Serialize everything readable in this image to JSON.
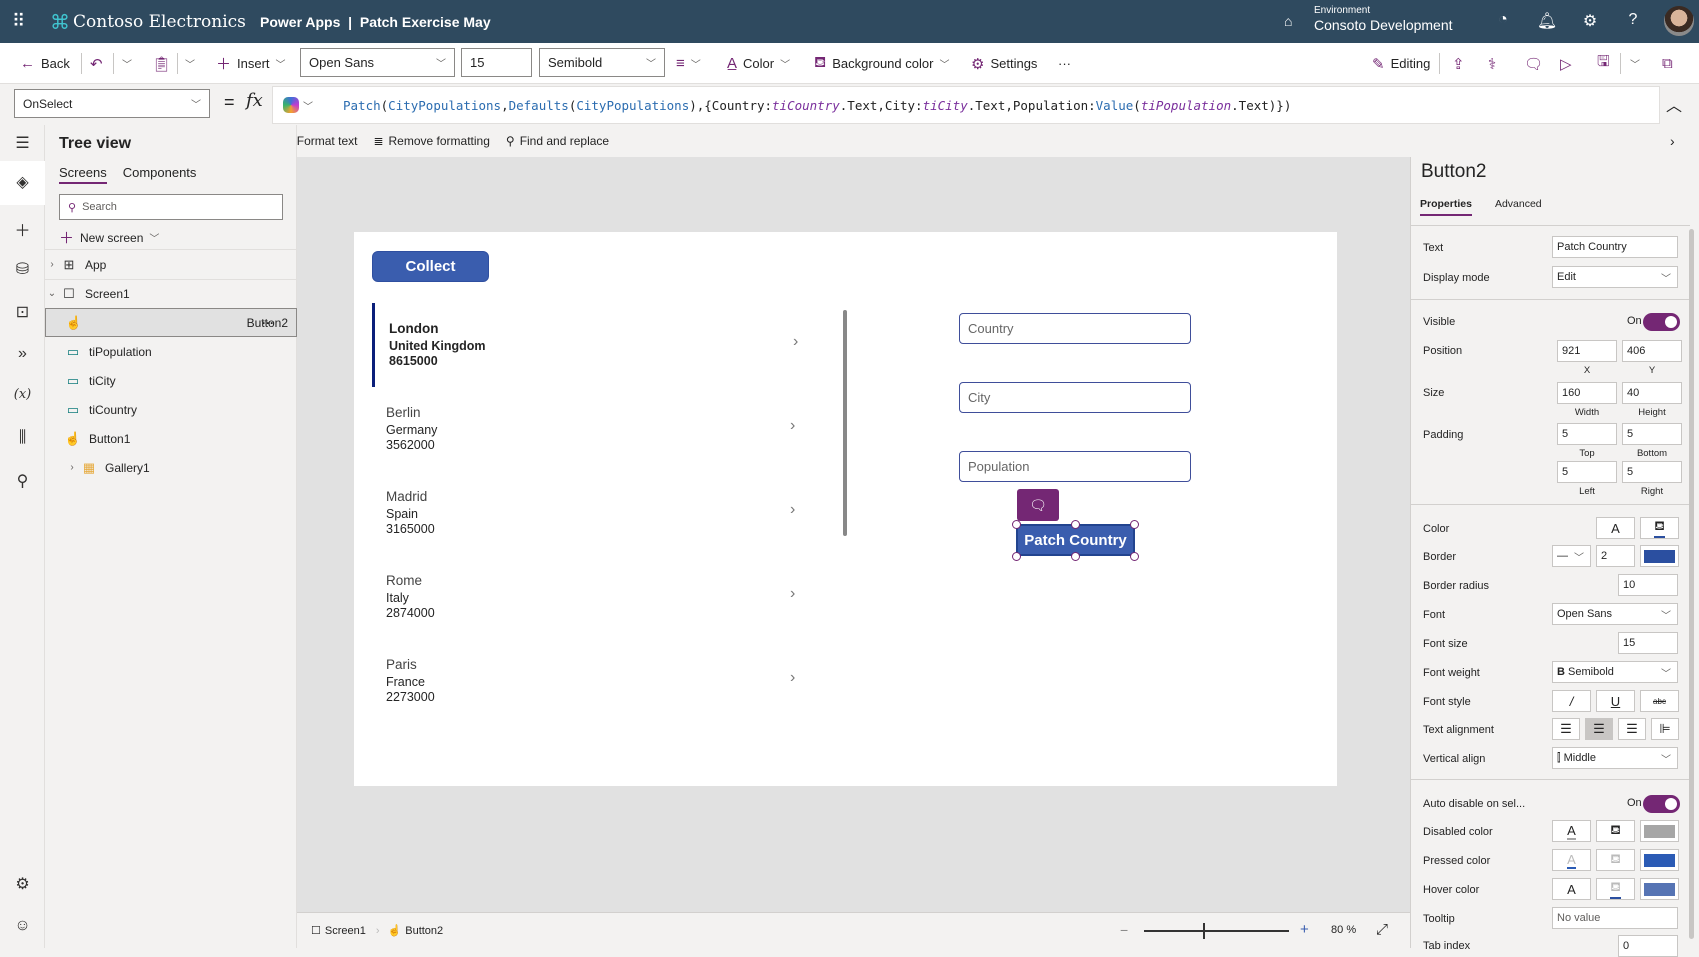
{
  "topbar": {
    "brand": "Contoso Electronics",
    "app_title": "Power Apps  |  Patch Exercise May",
    "environment_label": "Environment",
    "environment_name": "Consoto Development"
  },
  "toolbar": {
    "back": "Back",
    "insert": "Insert",
    "font": "Open Sans",
    "font_size": "15",
    "font_weight": "Semibold",
    "color": "Color",
    "background_color": "Background color",
    "settings": "Settings",
    "more": "···",
    "editing": "Editing"
  },
  "formula": {
    "property": "OnSelect",
    "equals": "=",
    "fx": "fx",
    "tokens": [
      {
        "t": "Patch",
        "c": "fn"
      },
      {
        "t": "(",
        "c": "pl"
      },
      {
        "t": "CityPopulations",
        "c": "fn"
      },
      {
        "t": ",",
        "c": "pl"
      },
      {
        "t": "Defaults",
        "c": "fn"
      },
      {
        "t": "(",
        "c": "pl"
      },
      {
        "t": "CityPopulations",
        "c": "fn"
      },
      {
        "t": "),{Country:",
        "c": "pl"
      },
      {
        "t": "tiCountry",
        "c": "it"
      },
      {
        "t": ".Text,City:",
        "c": "pl"
      },
      {
        "t": "tiCity",
        "c": "it"
      },
      {
        "t": ".Text,Population:",
        "c": "pl"
      },
      {
        "t": "Value",
        "c": "fn"
      },
      {
        "t": "(",
        "c": "pl"
      },
      {
        "t": "tiPopulation",
        "c": "it"
      },
      {
        "t": ".Text)})",
        "c": "pl"
      }
    ],
    "format_text": "Format text",
    "remove_formatting": "Remove formatting",
    "find_replace": "Find and replace"
  },
  "tree": {
    "title": "Tree view",
    "tabs": [
      "Screens",
      "Components"
    ],
    "search_placeholder": "Search",
    "new_screen": "New screen",
    "items": [
      {
        "label": "App",
        "icon": "app-icon"
      },
      {
        "label": "Screen1",
        "icon": "screen-icon"
      },
      {
        "label": "Button2",
        "icon": "button-icon",
        "selected": true
      },
      {
        "label": "tiPopulation",
        "icon": "textinput-icon"
      },
      {
        "label": "tiCity",
        "icon": "textinput-icon"
      },
      {
        "label": "tiCountry",
        "icon": "textinput-icon"
      },
      {
        "label": "Button1",
        "icon": "button-icon"
      },
      {
        "label": "Gallery1",
        "icon": "gallery-icon"
      }
    ],
    "more": "···"
  },
  "canvas": {
    "collect_label": "Collect",
    "gallery": [
      {
        "city": "London",
        "country": "United Kingdom",
        "population": "8615000"
      },
      {
        "city": "Berlin",
        "country": "Germany",
        "population": "3562000"
      },
      {
        "city": "Madrid",
        "country": "Spain",
        "population": "3165000"
      },
      {
        "city": "Rome",
        "country": "Italy",
        "population": "2874000"
      },
      {
        "city": "Paris",
        "country": "France",
        "population": "2273000"
      }
    ],
    "inputs": {
      "country": "Country",
      "city": "City",
      "population": "Population"
    },
    "patch_label": "Patch Country"
  },
  "bottombar": {
    "screen": "Screen1",
    "control": "Button2",
    "zoom": "80",
    "zoom_unit": "%"
  },
  "props": {
    "title": "Button2",
    "tabs": [
      "Properties",
      "Advanced"
    ],
    "text_label": "Text",
    "text_value": "Patch Country",
    "display_mode_label": "Display mode",
    "display_mode": "Edit",
    "visible_label": "Visible",
    "visible": "On",
    "position_label": "Position",
    "x": "921",
    "y": "406",
    "x_lbl": "X",
    "y_lbl": "Y",
    "size_label": "Size",
    "width": "160",
    "height": "40",
    "w_lbl": "Width",
    "h_lbl": "Height",
    "padding_label": "Padding",
    "pad_top": "5",
    "pad_bottom": "5",
    "pad_left": "5",
    "pad_right": "5",
    "top_lbl": "Top",
    "bottom_lbl": "Bottom",
    "left_lbl": "Left",
    "right_lbl": "Right",
    "color_label": "Color",
    "border_label": "Border",
    "border_width": "2",
    "border_color": "#2b4fa0",
    "border_radius_label": "Border radius",
    "border_radius": "10",
    "font_label": "Font",
    "font": "Open Sans",
    "font_size_label": "Font size",
    "font_size": "15",
    "font_weight_label": "Font weight",
    "font_weight": "Semibold",
    "font_style_label": "Font style",
    "text_align_label": "Text alignment",
    "vertical_align_label": "Vertical align",
    "vertical_align": "Middle",
    "auto_disable_label": "Auto disable on sel...",
    "auto_disable": "On",
    "disabled_color_label": "Disabled color",
    "disabled_fill": "#a6a6a6",
    "pressed_color_label": "Pressed color",
    "pressed_fill": "#2b5bb5",
    "hover_color_label": "Hover color",
    "hover_fill": "#5674b4",
    "tooltip_label": "Tooltip",
    "tooltip_placeholder": "No value",
    "tab_index_label": "Tab index",
    "tab_index": "0"
  },
  "colors": {
    "accent": "#742774",
    "button": "#3a5dae",
    "header": "#2f4a5f"
  }
}
